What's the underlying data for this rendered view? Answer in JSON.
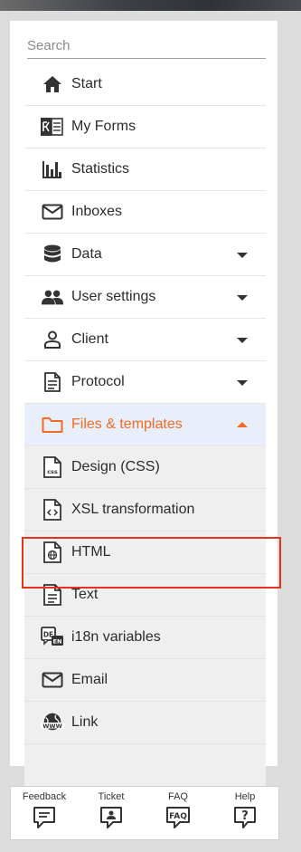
{
  "search": {
    "placeholder": "Search"
  },
  "menu": {
    "start": "Start",
    "my_forms": "My Forms",
    "statistics": "Statistics",
    "inboxes": "Inboxes",
    "data": "Data",
    "user_settings": "User settings",
    "client": "Client",
    "protocol": "Protocol",
    "files_templates": "Files & templates",
    "design_css": "Design (CSS)",
    "xsl_transformation": "XSL transformation",
    "html": "HTML",
    "text": "Text",
    "i18n_variables": "i18n variables",
    "email": "Email",
    "link": "Link"
  },
  "icons": {
    "start": "home-icon",
    "my_forms": "forms-icon",
    "statistics": "bar-chart-icon",
    "inboxes": "envelope-icon",
    "data": "database-icon",
    "user_settings": "users-icon",
    "client": "person-icon",
    "protocol": "document-icon",
    "files_templates": "folder-icon",
    "design_css": "css-file-icon",
    "xsl_transformation": "code-file-icon",
    "html": "globe-file-icon",
    "text": "text-file-icon",
    "i18n_variables": "translate-icon",
    "email": "envelope-icon",
    "link": "www-globe-icon"
  },
  "footer": {
    "feedback": "Feedback",
    "ticket": "Ticket",
    "faq": "FAQ",
    "help": "Help"
  },
  "colors": {
    "accent": "#f26b21",
    "active_bg": "#e8eefa",
    "highlight_border": "#e8321e"
  }
}
